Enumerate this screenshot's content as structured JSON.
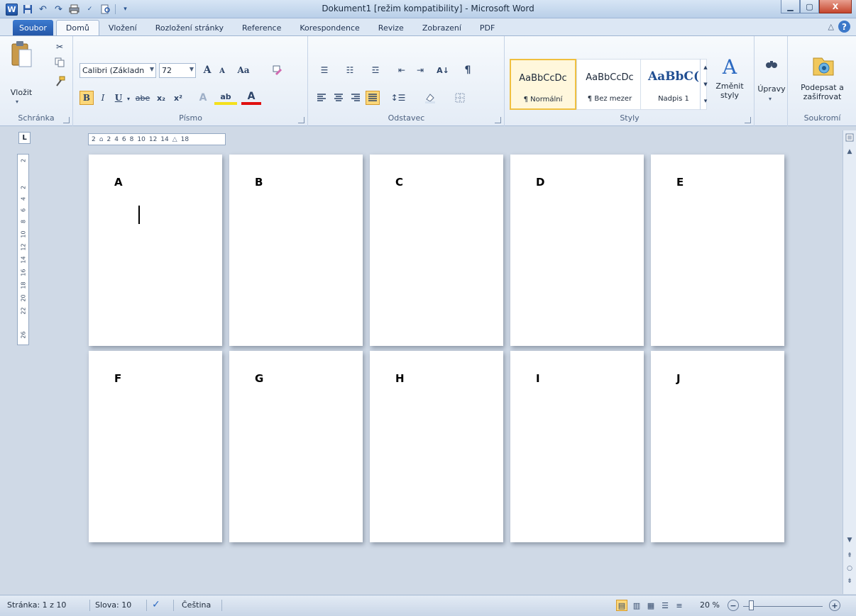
{
  "window": {
    "title": "Dokument1 [režim kompatibility] - Microsoft Word",
    "app_icon": "W",
    "controls": {
      "minimize": "▁",
      "maximize": "▢",
      "close": "X"
    }
  },
  "qat": {
    "icons": [
      "save-icon",
      "undo-icon",
      "redo-icon",
      "print-icon",
      "spellcheck-icon",
      "print-preview-icon",
      "customize-icon"
    ]
  },
  "tabs": [
    {
      "label": "Soubor"
    },
    {
      "label": "Domů"
    },
    {
      "label": "Vložení"
    },
    {
      "label": "Rozložení stránky"
    },
    {
      "label": "Reference"
    },
    {
      "label": "Korespondence"
    },
    {
      "label": "Revize"
    },
    {
      "label": "Zobrazení"
    },
    {
      "label": "PDF"
    }
  ],
  "ribbon": {
    "clipboard": {
      "paste_label": "Vložit",
      "group_label": "Schránka"
    },
    "font": {
      "font_name": "Calibri (Základn",
      "font_size": "72",
      "grow": "A",
      "shrink": "A",
      "case": "Aa",
      "bold": "B",
      "italic": "I",
      "underline": "U",
      "strike": "abe",
      "sub": "x₂",
      "sup": "x²",
      "highlight": "ab",
      "font_color": "A",
      "group_label": "Písmo"
    },
    "paragraph": {
      "sort": "A↓",
      "pilcrow": "¶",
      "group_label": "Odstavec"
    },
    "styles": {
      "tiles": [
        {
          "sample": "AaBbCcDc",
          "name": "¶ Normální"
        },
        {
          "sample": "AaBbCcDc",
          "name": "¶ Bez mezer"
        },
        {
          "sample": "AaBbC(",
          "name": "Nadpis 1"
        }
      ],
      "change_styles": "Změnit styly",
      "group_label": "Styly"
    },
    "editing": {
      "label": "Úpravy"
    },
    "privacy": {
      "sign_label": "Podepsat a zašifrovat",
      "group_label": "Soukromí"
    }
  },
  "ruler": {
    "tab_selector": "L",
    "h_marks": [
      "2",
      "2",
      "4",
      "6",
      "8",
      "10",
      "12",
      "14",
      "18"
    ],
    "v_marks": [
      "2",
      "2",
      "4",
      "6",
      "8",
      "10",
      "12",
      "14",
      "16",
      "18",
      "20",
      "22",
      "26"
    ]
  },
  "pages": [
    {
      "letter": "A"
    },
    {
      "letter": "B"
    },
    {
      "letter": "C"
    },
    {
      "letter": "D"
    },
    {
      "letter": "E"
    },
    {
      "letter": "F"
    },
    {
      "letter": "G"
    },
    {
      "letter": "H"
    },
    {
      "letter": "I"
    },
    {
      "letter": "J"
    }
  ],
  "status": {
    "page": "Stránka: 1 z 10",
    "words": "Slova: 10",
    "language": "Čeština",
    "zoom": "20 %",
    "zoom_fraction": 0.1,
    "plus": "+",
    "minus": "−"
  },
  "colors": {
    "file_tab": "#2f69bf",
    "selected_style": "#f0c040",
    "close_button": "#c5452d"
  }
}
